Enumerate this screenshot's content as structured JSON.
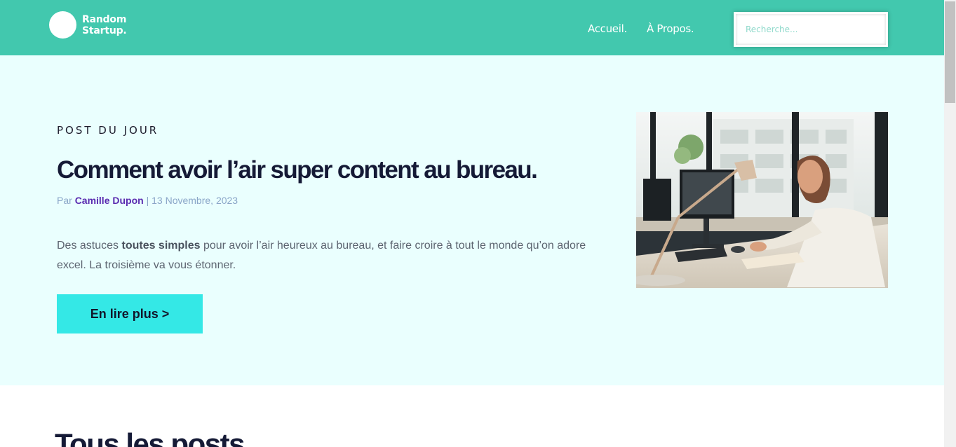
{
  "header": {
    "logo_line1": "Random",
    "logo_line2": "Startup.",
    "nav": [
      {
        "label": "Accueil."
      },
      {
        "label": "À Propos."
      }
    ],
    "search_placeholder": "Recherche..."
  },
  "hero": {
    "kicker": "POST DU JOUR",
    "title": "Comment avoir l’air super content au bureau.",
    "meta_prefix": "Par",
    "author": "Camille Dupon",
    "separator": "|",
    "date": "13 Novembre, 2023",
    "excerpt_start": "Des astuces ",
    "excerpt_bold": "toutes simples",
    "excerpt_end": " pour avoir l’air heureux au bureau, et faire croire à tout le monde qu’on adore excel. La troisième va vous étonner.",
    "cta_label": "En lire plus >"
  },
  "section": {
    "title": "Tous les posts"
  },
  "colors": {
    "header_bg": "#42c8ae",
    "hero_bg": "#eafffe",
    "cta_bg": "#34e8e6",
    "author": "#5a2bb0"
  }
}
